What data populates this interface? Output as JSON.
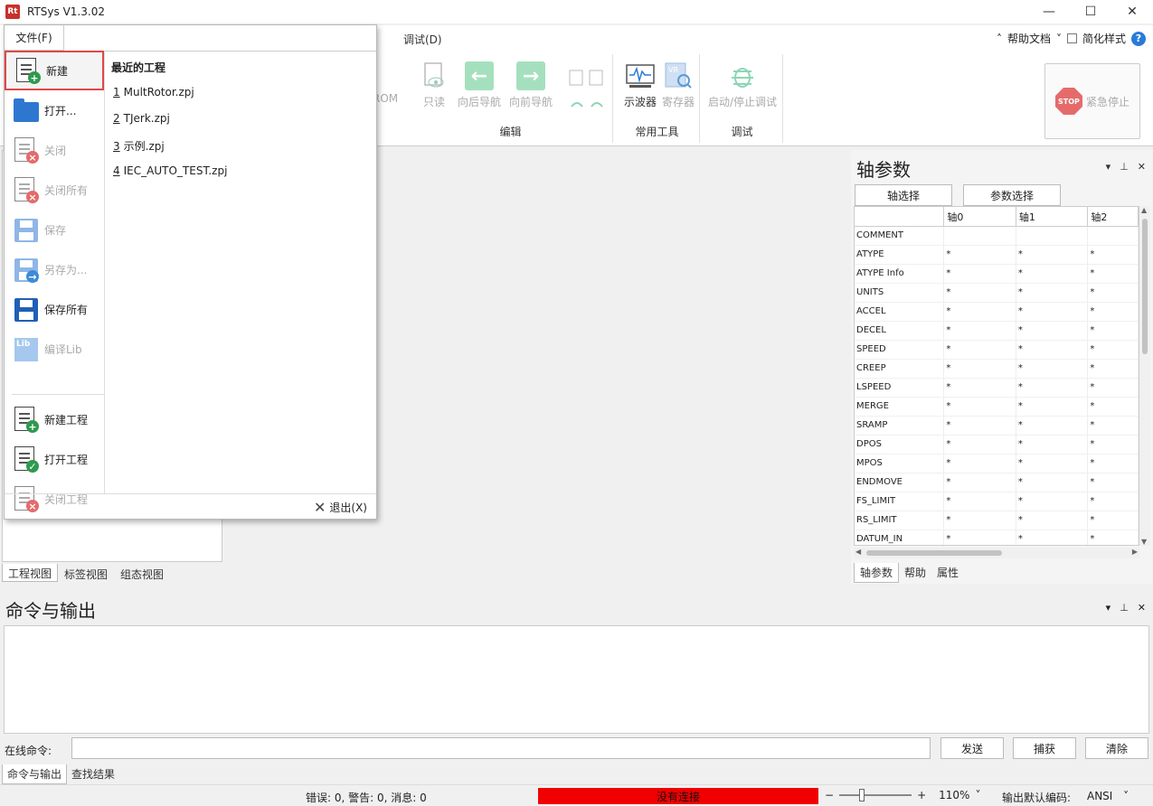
{
  "window": {
    "title": "RTSys V1.3.02",
    "icon_text": "Rt",
    "minimize": "—",
    "maximize": "☐",
    "close": "✕"
  },
  "menubar": {
    "debug": "调试(D)",
    "help_docs": "帮助文档",
    "simple_style": "简化样式",
    "help_icon": "?"
  },
  "ribbon": {
    "rom_fragment": "ROM",
    "buttons": {
      "readonly": "只读",
      "nav_back": "向后导航",
      "nav_forward": "向前导航",
      "oscilloscope": "示波器",
      "register": "寄存器",
      "start_stop_debug": "启动/停止调试"
    },
    "groups": {
      "edit": "编辑",
      "tools": "常用工具",
      "debug": "调试"
    },
    "emergency_stop": "紧急停止",
    "stop_text": "STOP",
    "vr_text": "VR"
  },
  "file_menu": {
    "tab_label": "文件(F)",
    "items": [
      {
        "label": "新建",
        "enabled": true
      },
      {
        "label": "打开...",
        "enabled": true
      },
      {
        "label": "关闭",
        "enabled": false
      },
      {
        "label": "关闭所有",
        "enabled": false
      },
      {
        "label": "保存",
        "enabled": false
      },
      {
        "label": "另存为...",
        "enabled": false
      },
      {
        "label": "保存所有",
        "enabled": true
      },
      {
        "label": "编译Lib",
        "enabled": false
      },
      {
        "label": "新建工程",
        "enabled": true
      },
      {
        "label": "打开工程",
        "enabled": true
      },
      {
        "label": "关闭工程",
        "enabled": false
      }
    ],
    "recent_title": "最近的工程",
    "recent": [
      {
        "num": "1",
        "name": "MultRotor.zpj"
      },
      {
        "num": "2",
        "name": "TJerk.zpj"
      },
      {
        "num": "3",
        "name": "示例.zpj"
      },
      {
        "num": "4",
        "name": "IEC_AUTO_TEST.zpj"
      }
    ],
    "exit": "退出(X)"
  },
  "left_tabs": [
    "工程视图",
    "标签视图",
    "组态视图"
  ],
  "axis_panel": {
    "title": "轴参数",
    "axis_select": "轴选择",
    "param_select": "参数选择",
    "columns": [
      "",
      "轴0",
      "轴1",
      "轴2"
    ],
    "rows": [
      {
        "name": "COMMENT",
        "v": [
          "",
          "",
          ""
        ]
      },
      {
        "name": "ATYPE",
        "v": [
          "*",
          "*",
          "*"
        ]
      },
      {
        "name": "ATYPE Info",
        "v": [
          "*",
          "*",
          "*"
        ]
      },
      {
        "name": "UNITS",
        "v": [
          "*",
          "*",
          "*"
        ]
      },
      {
        "name": "ACCEL",
        "v": [
          "*",
          "*",
          "*"
        ]
      },
      {
        "name": "DECEL",
        "v": [
          "*",
          "*",
          "*"
        ]
      },
      {
        "name": "SPEED",
        "v": [
          "*",
          "*",
          "*"
        ]
      },
      {
        "name": "CREEP",
        "v": [
          "*",
          "*",
          "*"
        ]
      },
      {
        "name": "LSPEED",
        "v": [
          "*",
          "*",
          "*"
        ]
      },
      {
        "name": "MERGE",
        "v": [
          "*",
          "*",
          "*"
        ]
      },
      {
        "name": "SRAMP",
        "v": [
          "*",
          "*",
          "*"
        ]
      },
      {
        "name": "DPOS",
        "v": [
          "*",
          "*",
          "*"
        ]
      },
      {
        "name": "MPOS",
        "v": [
          "*",
          "*",
          "*"
        ]
      },
      {
        "name": "ENDMOVE",
        "v": [
          "*",
          "*",
          "*"
        ]
      },
      {
        "name": "FS_LIMIT",
        "v": [
          "*",
          "*",
          "*"
        ]
      },
      {
        "name": "RS_LIMIT",
        "v": [
          "*",
          "*",
          "*"
        ]
      },
      {
        "name": "DATUM_IN",
        "v": [
          "*",
          "*",
          "*"
        ]
      }
    ],
    "tabs": [
      "轴参数",
      "帮助",
      "属性"
    ]
  },
  "output": {
    "title": "命令与输出",
    "cmd_label": "在线命令:",
    "send": "发送",
    "capture": "捕获",
    "clear": "清除",
    "tabs": [
      "命令与输出",
      "查找结果"
    ]
  },
  "status": {
    "counts": "错误: 0, 警告: 0, 消息: 0",
    "connection": "没有连接",
    "zoom": "110%",
    "encoding_label": "输出默认编码:",
    "encoding": "ANSI"
  },
  "colors": {
    "accent_red": "#e04848",
    "status_red": "#f00000",
    "green": "#2e9a4e"
  }
}
